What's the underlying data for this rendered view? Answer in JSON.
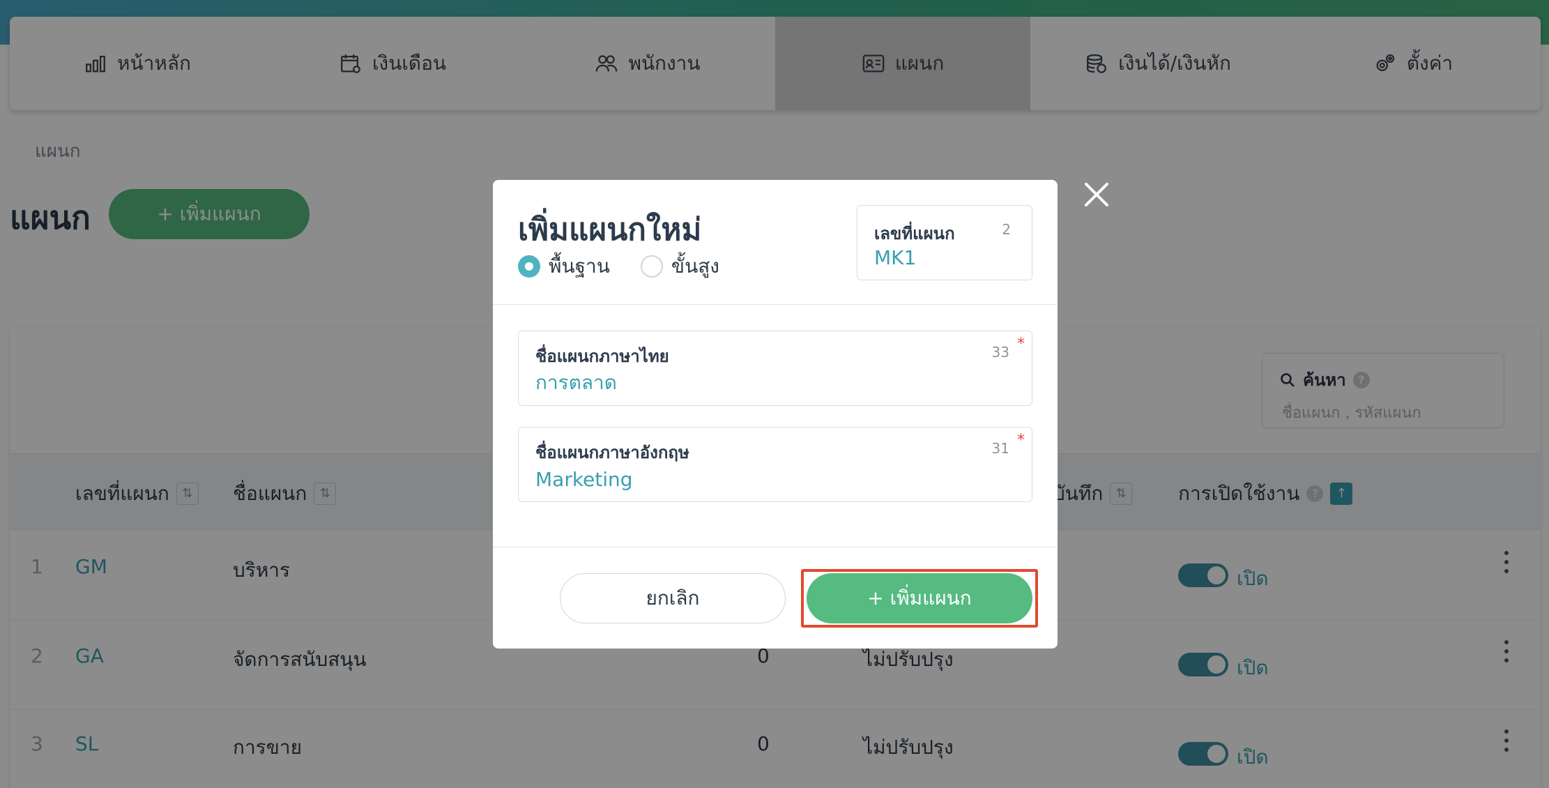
{
  "nav": {
    "items": [
      {
        "label": "หน้าหลัก",
        "icon": "bar-chart-icon"
      },
      {
        "label": "เงินเดือน",
        "icon": "calendar-icon"
      },
      {
        "label": "พนักงาน",
        "icon": "people-icon"
      },
      {
        "label": "แผนก",
        "icon": "id-card-icon"
      },
      {
        "label": "เงินได้/เงินหัก",
        "icon": "money-stack-icon"
      },
      {
        "label": "ตั้งค่า",
        "icon": "gears-icon"
      }
    ],
    "active_index": 3
  },
  "breadcrumb": "แผนก",
  "page": {
    "title": "แผนก",
    "add_button": "+ เพิ่มแผนก"
  },
  "search": {
    "label": "ค้นหา",
    "help": "?",
    "placeholder": "ชื่อแผนก , รหัสแผนก"
  },
  "table": {
    "headers": {
      "code": "เลขที่แผนก",
      "name": "ชื่อแผนก",
      "saved": "บันทึก",
      "status": "การเปิดใช้งาน"
    },
    "rows": [
      {
        "index": "1",
        "code": "GM",
        "name": "บริหาร",
        "count": "",
        "update": "",
        "status": "เปิด"
      },
      {
        "index": "2",
        "code": "GA",
        "name": "จัดการสนับสนุน",
        "count": "0",
        "update": "ไม่ปรับปรุง",
        "status": "เปิด"
      },
      {
        "index": "3",
        "code": "SL",
        "name": "การขาย",
        "count": "0",
        "update": "ไม่ปรับปรุง",
        "status": "เปิด"
      }
    ]
  },
  "modal": {
    "title": "เพิ่มแผนกใหม่",
    "radio_basic": "พื้นฐาน",
    "radio_advanced": "ขั้นสูง",
    "selected_mode": "basic",
    "code_field": {
      "label": "เลขที่แผนก",
      "count": "2",
      "value": "MK1"
    },
    "name_th": {
      "label": "ชื่อแผนกภาษาไทย",
      "count": "33",
      "required": "*",
      "value": "การตลาด"
    },
    "name_en": {
      "label": "ชื่อแผนกภาษาอังกฤษ",
      "count": "31",
      "required": "*",
      "value": "Marketing"
    },
    "cancel_button": "ยกเลิก",
    "submit_button": "+ เพิ่มแผนก",
    "close_icon": "close-icon"
  },
  "colors": {
    "accent": "#3a9fb0",
    "primary_button": "#55bb80",
    "highlight": "#e04a2f"
  }
}
